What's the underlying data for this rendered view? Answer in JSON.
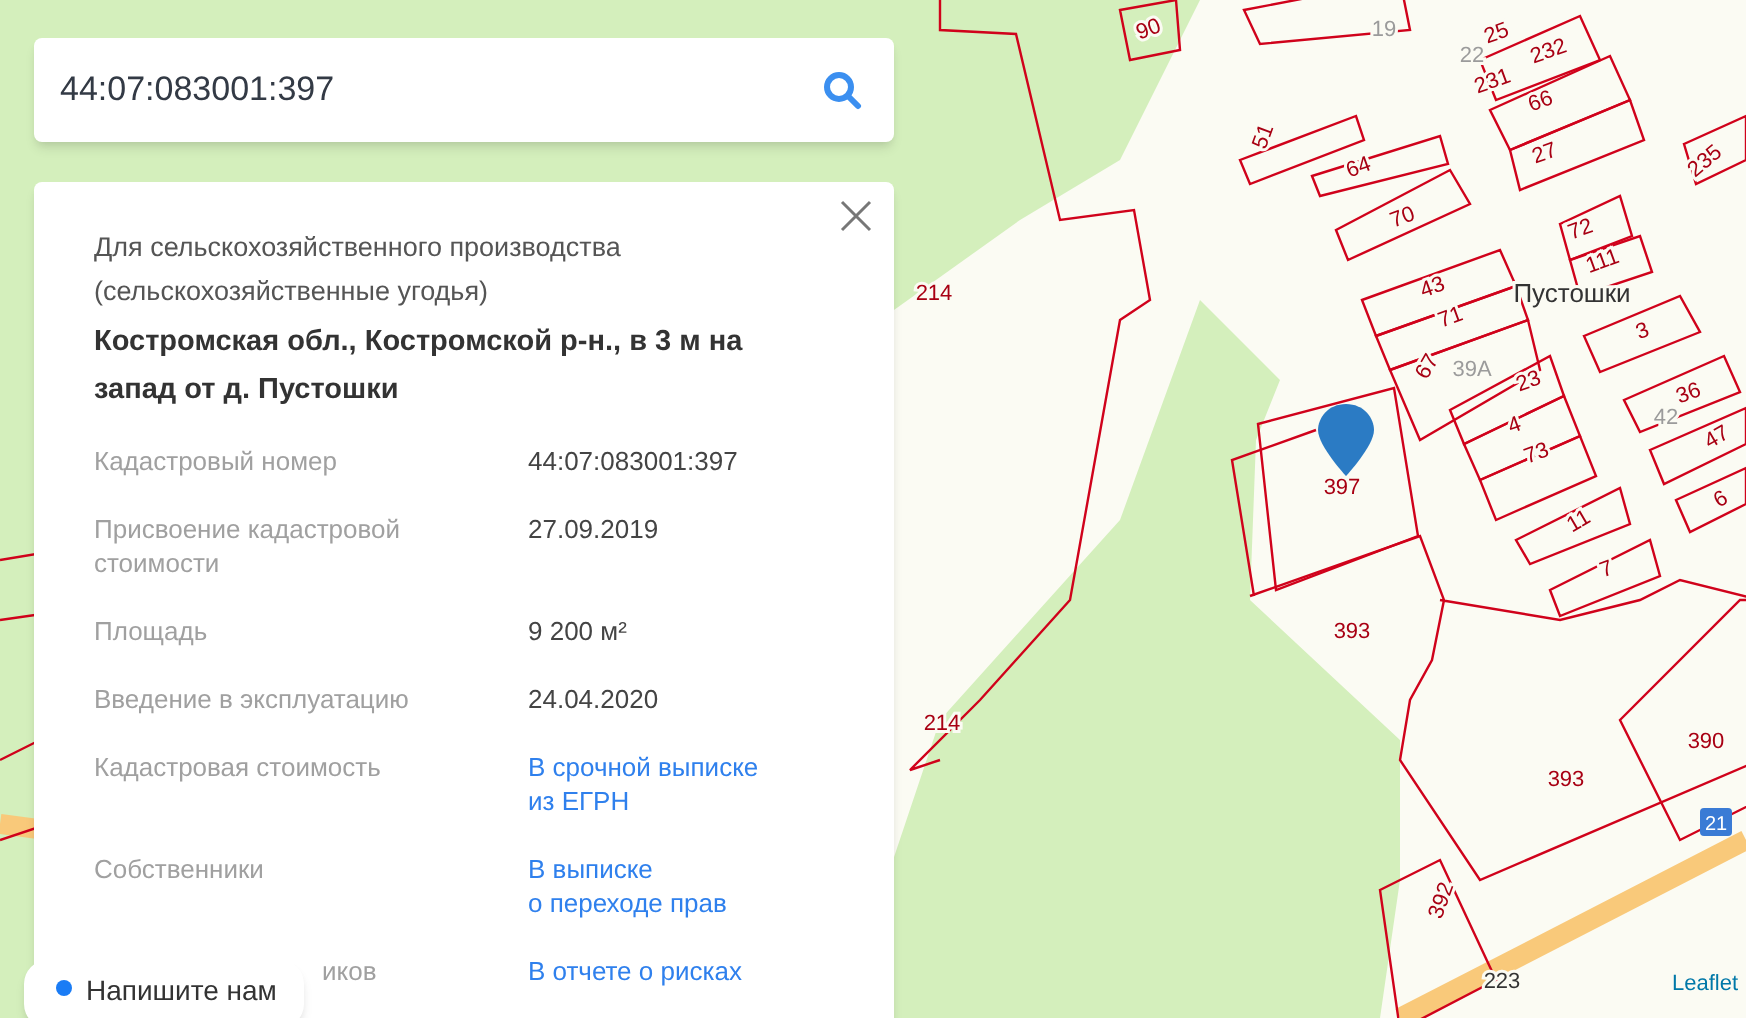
{
  "search": {
    "value": "44:07:083001:397"
  },
  "card": {
    "category": "Для сельскохозяйственного производства (сельскохозяйственные угодья)",
    "address": "Костромская обл., Костромской р-н., в 3 м на запад от д. Пустошки",
    "rows": [
      {
        "label": "Кадастровый номер",
        "value": "44:07:083001:397",
        "kind": "text",
        "obscured": false
      },
      {
        "label": "Присвоение кадастровой стоимости",
        "value": "27.09.2019",
        "kind": "text",
        "obscured": false
      },
      {
        "label": "Площадь",
        "value": "9 200 м²",
        "kind": "text",
        "obscured": false
      },
      {
        "label": "Введение в эксплуатацию",
        "value": "24.04.2020",
        "kind": "text",
        "obscured": false
      },
      {
        "label": "Кадастровая стоимость",
        "value": "В срочной выписке\nиз ЕГРН",
        "kind": "link",
        "obscured": false
      },
      {
        "label": "Собственники",
        "value": "В выписке\nо переходе прав",
        "kind": "link",
        "obscured": false
      },
      {
        "label": "иков",
        "value": "В отчете о рисках",
        "kind": "link",
        "obscured": true
      }
    ]
  },
  "chat": {
    "label": "Напишите нам"
  },
  "map": {
    "labels": [
      "90",
      "19",
      "25",
      "22",
      "232",
      "231",
      "66",
      "27",
      "51",
      "64",
      "70",
      "72",
      "111",
      "235",
      "Пустошки",
      "43",
      "71",
      "3",
      "67",
      "39А",
      "23",
      "36",
      "4",
      "73",
      "42",
      "47",
      "11",
      "6",
      "7",
      "397",
      "214",
      "214",
      "393",
      "393",
      "390",
      "392",
      "223",
      "21"
    ],
    "attribution": "Leaflet"
  }
}
